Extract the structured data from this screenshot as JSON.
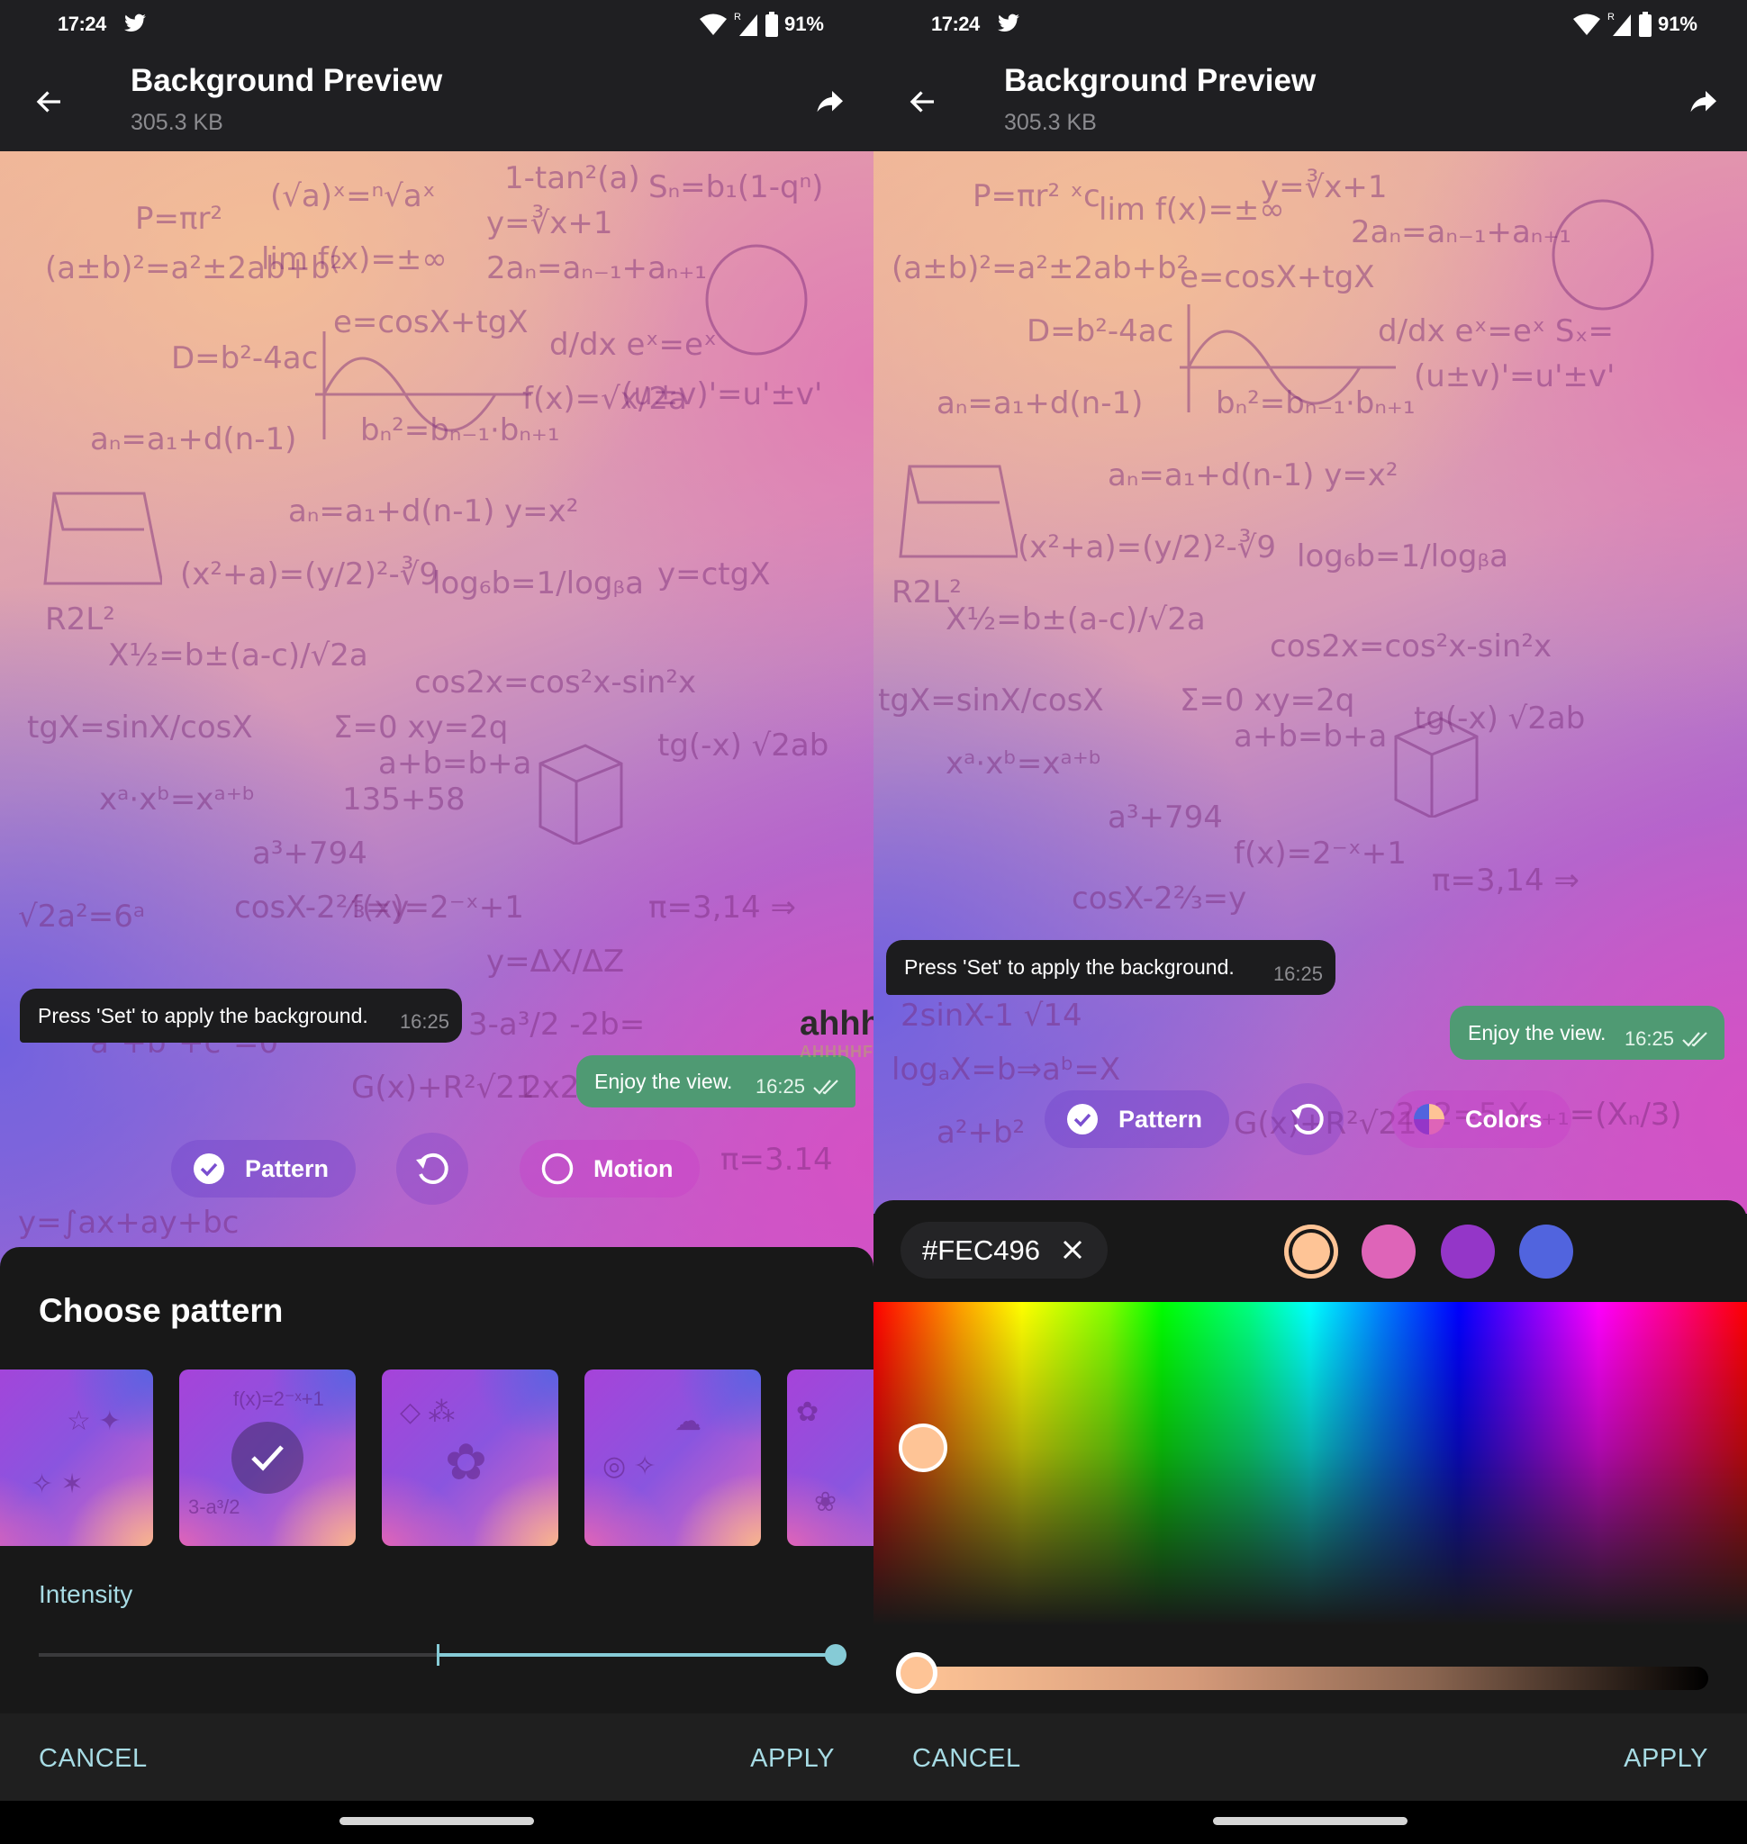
{
  "status_bar": {
    "time": "17:24",
    "notification_icon": "twitter-icon",
    "network": "R",
    "battery": "91%"
  },
  "app_bar": {
    "title": "Background Preview",
    "subtitle": "305.3 KB",
    "back_icon": "arrow-left-icon",
    "share_icon": "share-icon"
  },
  "messages": {
    "incoming": {
      "text": "Press 'Set' to apply the background.",
      "time": "16:25"
    },
    "outgoing": {
      "text": "Enjoy the view.",
      "time": "16:25",
      "status": "read"
    }
  },
  "watermark": {
    "logo": "ahhhhfs",
    "url": "AHHHHFS.COM"
  },
  "left_panel": {
    "actions": {
      "pattern_label": "Pattern",
      "pattern_checked": true,
      "motion_label": "Motion",
      "motion_checked": false
    },
    "sheet": {
      "title": "Choose pattern",
      "patterns": [
        {
          "name": "stars-crystals",
          "selected": false
        },
        {
          "name": "math-formulas",
          "selected": true
        },
        {
          "name": "flowers-shapes",
          "selected": false
        },
        {
          "name": "animals",
          "selected": false
        },
        {
          "name": "floral",
          "selected": false
        }
      ],
      "intensity_label": "Intensity",
      "intensity": {
        "min": -100,
        "max": 100,
        "value": 100
      },
      "cancel_label": "CANCEL",
      "apply_label": "APPLY"
    }
  },
  "right_panel": {
    "actions": {
      "pattern_label": "Pattern",
      "pattern_checked": true,
      "colors_label": "Colors"
    },
    "sheet": {
      "hex_value": "#FEC496",
      "swatches": [
        {
          "color": "#FEC496",
          "selected": true
        },
        {
          "color": "#DE64B8",
          "selected": false
        },
        {
          "color": "#9436C8",
          "selected": false
        },
        {
          "color": "#5164DE",
          "selected": false
        }
      ],
      "picker": {
        "hue_fraction": 0.04,
        "saturation_fraction": 0.45
      },
      "brightness": 1.0,
      "cancel_label": "CANCEL",
      "apply_label": "APPLY"
    }
  }
}
